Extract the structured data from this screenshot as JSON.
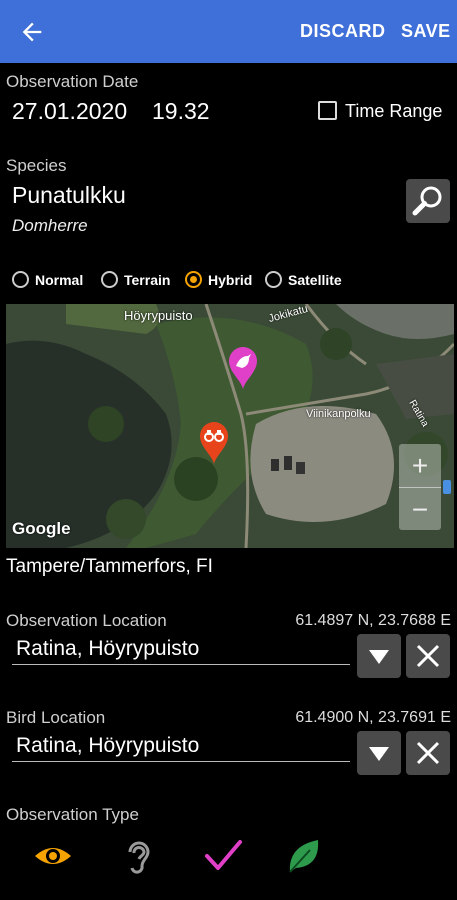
{
  "appbar": {
    "discard_label": "DISCARD",
    "save_label": "SAVE"
  },
  "observation_date": {
    "label": "Observation Date",
    "date": "27.01.2020",
    "time": "19.32",
    "time_range_label": "Time Range",
    "time_range_checked": false
  },
  "species": {
    "label": "Species",
    "name": "Punatulkku",
    "alt_name": "Domherre"
  },
  "map_types": [
    {
      "label": "Normal",
      "selected": false
    },
    {
      "label": "Terrain",
      "selected": false
    },
    {
      "label": "Hybrid",
      "selected": true
    },
    {
      "label": "Satellite",
      "selected": false
    }
  ],
  "map": {
    "labels": [
      "Höyrypuisto",
      "Jokikatu",
      "Viinikanpolku",
      "Ratina"
    ],
    "logo": "Google",
    "zoom_in": "+",
    "zoom_out": "−"
  },
  "place_name": "Tampere/Tammerfors, FI",
  "observation_location": {
    "label": "Observation Location",
    "coords": "61.4897 N, 23.7688 E",
    "value": "Ratina, Höyrypuisto"
  },
  "bird_location": {
    "label": "Bird Location",
    "coords": "61.4900 N, 23.7691 E",
    "value": "Ratina, Höyrypuisto"
  },
  "observation_type": {
    "label": "Observation Type",
    "icons": [
      "eye-icon",
      "ear-icon",
      "check-icon",
      "leaf-icon"
    ]
  },
  "colors": {
    "appbar": "#3f6fd8",
    "accent": "#f5a300",
    "bird_marker": "#e040c8",
    "observer_marker": "#e8441c",
    "check": "#e040c8",
    "leaf": "#2e9b4c"
  }
}
